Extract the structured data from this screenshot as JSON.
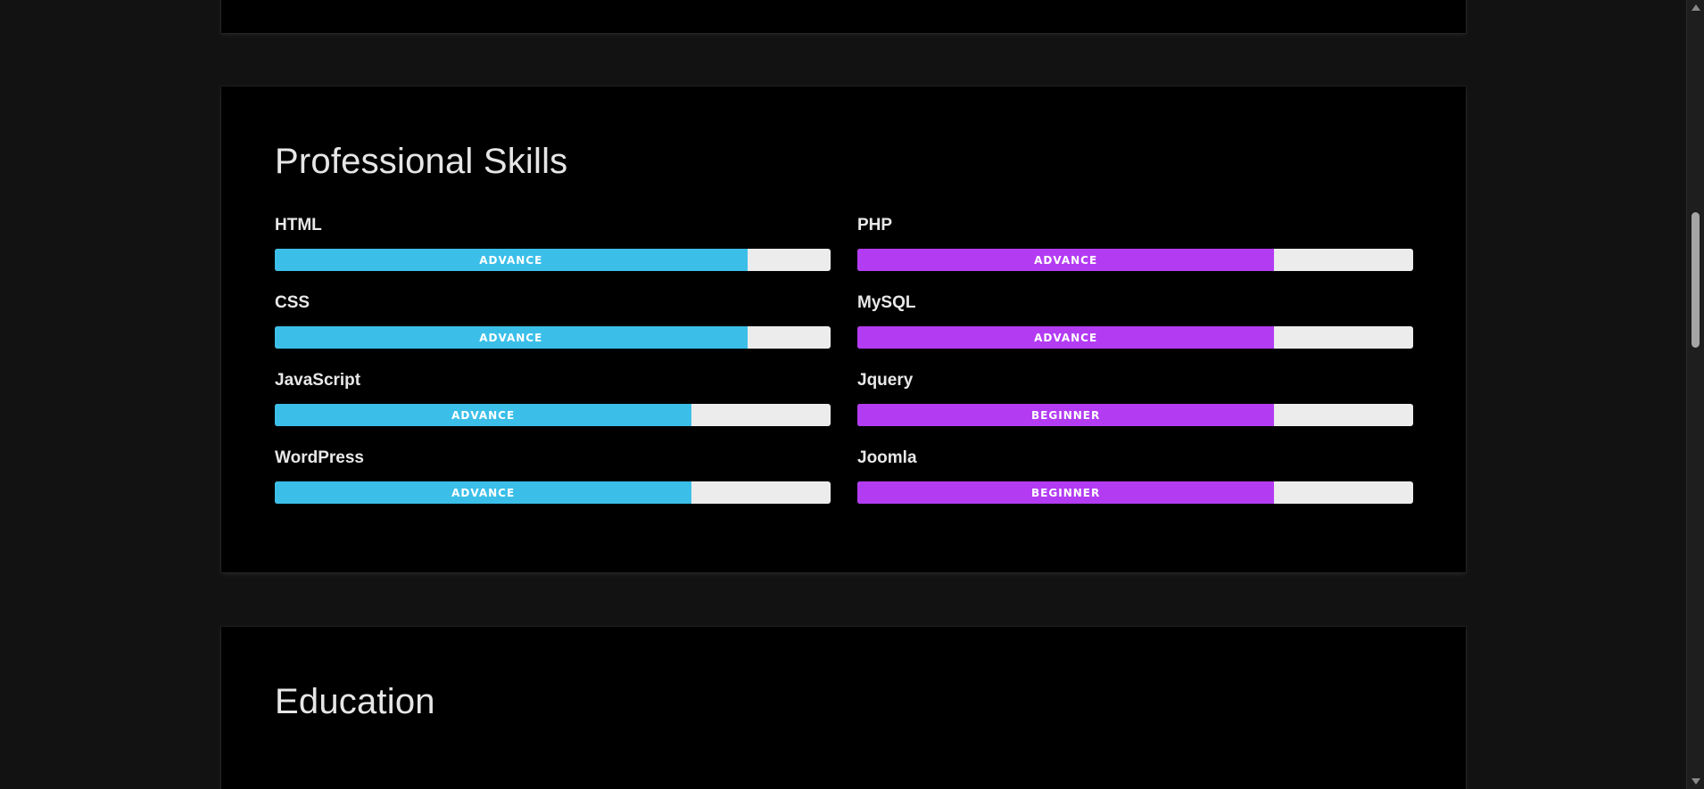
{
  "skills_section": {
    "title": "Professional Skills",
    "left_color": "#3bbfe9",
    "right_color": "#b33cf3",
    "left": [
      {
        "name": "HTML",
        "level": "ADVANCE",
        "percent": 85
      },
      {
        "name": "CSS",
        "level": "ADVANCE",
        "percent": 85
      },
      {
        "name": "JavaScript",
        "level": "ADVANCE",
        "percent": 75
      },
      {
        "name": "WordPress",
        "level": "ADVANCE",
        "percent": 75
      }
    ],
    "right": [
      {
        "name": "PHP",
        "level": "ADVANCE",
        "percent": 75
      },
      {
        "name": "MySQL",
        "level": "ADVANCE",
        "percent": 75
      },
      {
        "name": "Jquery",
        "level": "BEGINNER",
        "percent": 75
      },
      {
        "name": "Joomla",
        "level": "BEGINNER",
        "percent": 75
      }
    ]
  },
  "education_section": {
    "title": "Education"
  }
}
